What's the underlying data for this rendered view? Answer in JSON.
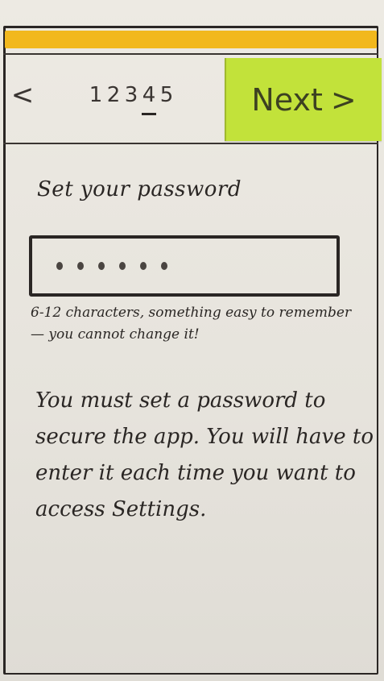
{
  "nav": {
    "back_label": "<",
    "steps": [
      "1",
      "2",
      "3",
      "4",
      "5"
    ],
    "current_step": "4",
    "next_label": "Next",
    "next_chevron": ">"
  },
  "form": {
    "label": "Set your password",
    "password_mask": "••••••",
    "hint": "6-12 characters, something easy to remember — you cannot change it!"
  },
  "info_text": "You must set a password to secure the app. You will have to enter it each time you want to access Settings.",
  "colors": {
    "status_bar": "#f2b81d",
    "next_button": "#c2e23a",
    "ink": "#2a2624"
  }
}
